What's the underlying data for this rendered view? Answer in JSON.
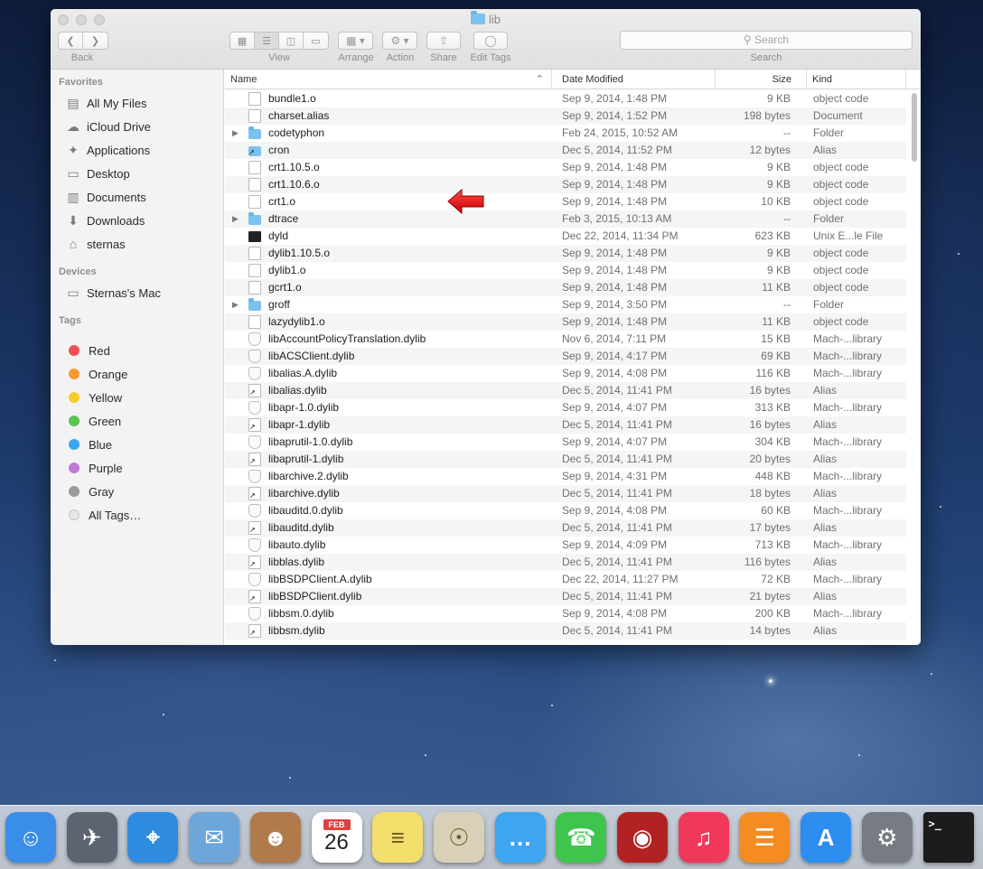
{
  "window": {
    "title": "lib",
    "toolbar": {
      "back_label": "Back",
      "view_label": "View",
      "arrange_label": "Arrange",
      "action_label": "Action",
      "share_label": "Share",
      "edit_tags_label": "Edit Tags",
      "search_placeholder": "Search",
      "search_label": "Search"
    }
  },
  "sidebar": {
    "favorites_header": "Favorites",
    "favorites": [
      {
        "label": "All My Files",
        "icon": "all-files-icon"
      },
      {
        "label": "iCloud Drive",
        "icon": "cloud-icon"
      },
      {
        "label": "Applications",
        "icon": "applications-icon"
      },
      {
        "label": "Desktop",
        "icon": "desktop-icon"
      },
      {
        "label": "Documents",
        "icon": "documents-icon"
      },
      {
        "label": "Downloads",
        "icon": "downloads-icon"
      },
      {
        "label": "sternas",
        "icon": "home-icon"
      }
    ],
    "devices_header": "Devices",
    "devices": [
      {
        "label": "Sternas's Mac",
        "icon": "computer-icon"
      }
    ],
    "tags_header": "Tags",
    "tags": [
      {
        "label": "Red",
        "color": "#f05053"
      },
      {
        "label": "Orange",
        "color": "#f79a36"
      },
      {
        "label": "Yellow",
        "color": "#f5cc2e"
      },
      {
        "label": "Green",
        "color": "#5ac451"
      },
      {
        "label": "Blue",
        "color": "#3ea6f0"
      },
      {
        "label": "Purple",
        "color": "#c17ad6"
      },
      {
        "label": "Gray",
        "color": "#9a9a9a"
      }
    ],
    "all_tags": "All Tags…"
  },
  "columns": {
    "name": "Name",
    "date": "Date Modified",
    "size": "Size",
    "kind": "Kind"
  },
  "files": [
    {
      "name": "bundle1.o",
      "date": "Sep 9, 2014, 1:48 PM",
      "size": "9 KB",
      "kind": "object code",
      "type": "doc"
    },
    {
      "name": "charset.alias",
      "date": "Sep 9, 2014, 1:52 PM",
      "size": "198 bytes",
      "kind": "Document",
      "type": "doc"
    },
    {
      "name": "codetyphon",
      "date": "Feb 24, 2015, 10:52 AM",
      "size": "--",
      "kind": "Folder",
      "type": "folder"
    },
    {
      "name": "cron",
      "date": "Dec 5, 2014, 11:52 PM",
      "size": "12 bytes",
      "kind": "Alias",
      "type": "alias-folder"
    },
    {
      "name": "crt1.10.5.o",
      "date": "Sep 9, 2014, 1:48 PM",
      "size": "9 KB",
      "kind": "object code",
      "type": "doc"
    },
    {
      "name": "crt1.10.6.o",
      "date": "Sep 9, 2014, 1:48 PM",
      "size": "9 KB",
      "kind": "object code",
      "type": "doc"
    },
    {
      "name": "crt1.o",
      "date": "Sep 9, 2014, 1:48 PM",
      "size": "10 KB",
      "kind": "object code",
      "type": "doc"
    },
    {
      "name": "dtrace",
      "date": "Feb 3, 2015, 10:13 AM",
      "size": "--",
      "kind": "Folder",
      "type": "folder"
    },
    {
      "name": "dyld",
      "date": "Dec 22, 2014, 11:34 PM",
      "size": "623 KB",
      "kind": "Unix E...le File",
      "type": "exec"
    },
    {
      "name": "dylib1.10.5.o",
      "date": "Sep 9, 2014, 1:48 PM",
      "size": "9 KB",
      "kind": "object code",
      "type": "doc"
    },
    {
      "name": "dylib1.o",
      "date": "Sep 9, 2014, 1:48 PM",
      "size": "9 KB",
      "kind": "object code",
      "type": "doc"
    },
    {
      "name": "gcrt1.o",
      "date": "Sep 9, 2014, 1:48 PM",
      "size": "11 KB",
      "kind": "object code",
      "type": "doc"
    },
    {
      "name": "groff",
      "date": "Sep 9, 2014, 3:50 PM",
      "size": "--",
      "kind": "Folder",
      "type": "folder"
    },
    {
      "name": "lazydylib1.o",
      "date": "Sep 9, 2014, 1:48 PM",
      "size": "11 KB",
      "kind": "object code",
      "type": "doc"
    },
    {
      "name": "libAccountPolicyTranslation.dylib",
      "date": "Nov 6, 2014, 7:11 PM",
      "size": "15 KB",
      "kind": "Mach-...library",
      "type": "lib"
    },
    {
      "name": "libACSClient.dylib",
      "date": "Sep 9, 2014, 4:17 PM",
      "size": "69 KB",
      "kind": "Mach-...library",
      "type": "lib"
    },
    {
      "name": "libalias.A.dylib",
      "date": "Sep 9, 2014, 4:08 PM",
      "size": "116 KB",
      "kind": "Mach-...library",
      "type": "lib"
    },
    {
      "name": "libalias.dylib",
      "date": "Dec 5, 2014, 11:41 PM",
      "size": "16 bytes",
      "kind": "Alias",
      "type": "alias"
    },
    {
      "name": "libapr-1.0.dylib",
      "date": "Sep 9, 2014, 4:07 PM",
      "size": "313 KB",
      "kind": "Mach-...library",
      "type": "lib"
    },
    {
      "name": "libapr-1.dylib",
      "date": "Dec 5, 2014, 11:41 PM",
      "size": "16 bytes",
      "kind": "Alias",
      "type": "alias"
    },
    {
      "name": "libaprutil-1.0.dylib",
      "date": "Sep 9, 2014, 4:07 PM",
      "size": "304 KB",
      "kind": "Mach-...library",
      "type": "lib"
    },
    {
      "name": "libaprutil-1.dylib",
      "date": "Dec 5, 2014, 11:41 PM",
      "size": "20 bytes",
      "kind": "Alias",
      "type": "alias"
    },
    {
      "name": "libarchive.2.dylib",
      "date": "Sep 9, 2014, 4:31 PM",
      "size": "448 KB",
      "kind": "Mach-...library",
      "type": "lib"
    },
    {
      "name": "libarchive.dylib",
      "date": "Dec 5, 2014, 11:41 PM",
      "size": "18 bytes",
      "kind": "Alias",
      "type": "alias"
    },
    {
      "name": "libauditd.0.dylib",
      "date": "Sep 9, 2014, 4:08 PM",
      "size": "60 KB",
      "kind": "Mach-...library",
      "type": "lib"
    },
    {
      "name": "libauditd.dylib",
      "date": "Dec 5, 2014, 11:41 PM",
      "size": "17 bytes",
      "kind": "Alias",
      "type": "alias"
    },
    {
      "name": "libauto.dylib",
      "date": "Sep 9, 2014, 4:09 PM",
      "size": "713 KB",
      "kind": "Mach-...library",
      "type": "lib"
    },
    {
      "name": "libblas.dylib",
      "date": "Dec 5, 2014, 11:41 PM",
      "size": "116 bytes",
      "kind": "Alias",
      "type": "alias"
    },
    {
      "name": "libBSDPClient.A.dylib",
      "date": "Dec 22, 2014, 11:27 PM",
      "size": "72 KB",
      "kind": "Mach-...library",
      "type": "lib"
    },
    {
      "name": "libBSDPClient.dylib",
      "date": "Dec 5, 2014, 11:41 PM",
      "size": "21 bytes",
      "kind": "Alias",
      "type": "alias"
    },
    {
      "name": "libbsm.0.dylib",
      "date": "Sep 9, 2014, 4:08 PM",
      "size": "200 KB",
      "kind": "Mach-...library",
      "type": "lib"
    },
    {
      "name": "libbsm.dylib",
      "date": "Dec 5, 2014, 11:41 PM",
      "size": "14 bytes",
      "kind": "Alias",
      "type": "alias"
    }
  ],
  "dock": [
    {
      "name": "finder-icon",
      "color": "#3b8ee8"
    },
    {
      "name": "launchpad-icon",
      "color": "#5b6470"
    },
    {
      "name": "safari-icon",
      "color": "#2e8be0"
    },
    {
      "name": "mail-icon",
      "color": "#6fa6d9"
    },
    {
      "name": "contacts-icon",
      "color": "#b07a4a"
    },
    {
      "name": "calendar-icon",
      "color": "#ffffff",
      "month": "FEB",
      "day": "26"
    },
    {
      "name": "notes-icon",
      "color": "#f3de6b"
    },
    {
      "name": "maps-icon",
      "color": "#d9d0b8"
    },
    {
      "name": "messages-icon",
      "color": "#3ea6f0"
    },
    {
      "name": "facetime-icon",
      "color": "#3fc54d"
    },
    {
      "name": "photo-booth-icon",
      "color": "#b32222"
    },
    {
      "name": "itunes-icon",
      "color": "#f0385a"
    },
    {
      "name": "ibooks-icon",
      "color": "#f58c22"
    },
    {
      "name": "app-store-icon",
      "color": "#2d8ef0"
    },
    {
      "name": "system-preferences-icon",
      "color": "#777c84"
    },
    {
      "name": "terminal-icon",
      "color": "#1c1c1c",
      "glyph": ">_"
    }
  ]
}
